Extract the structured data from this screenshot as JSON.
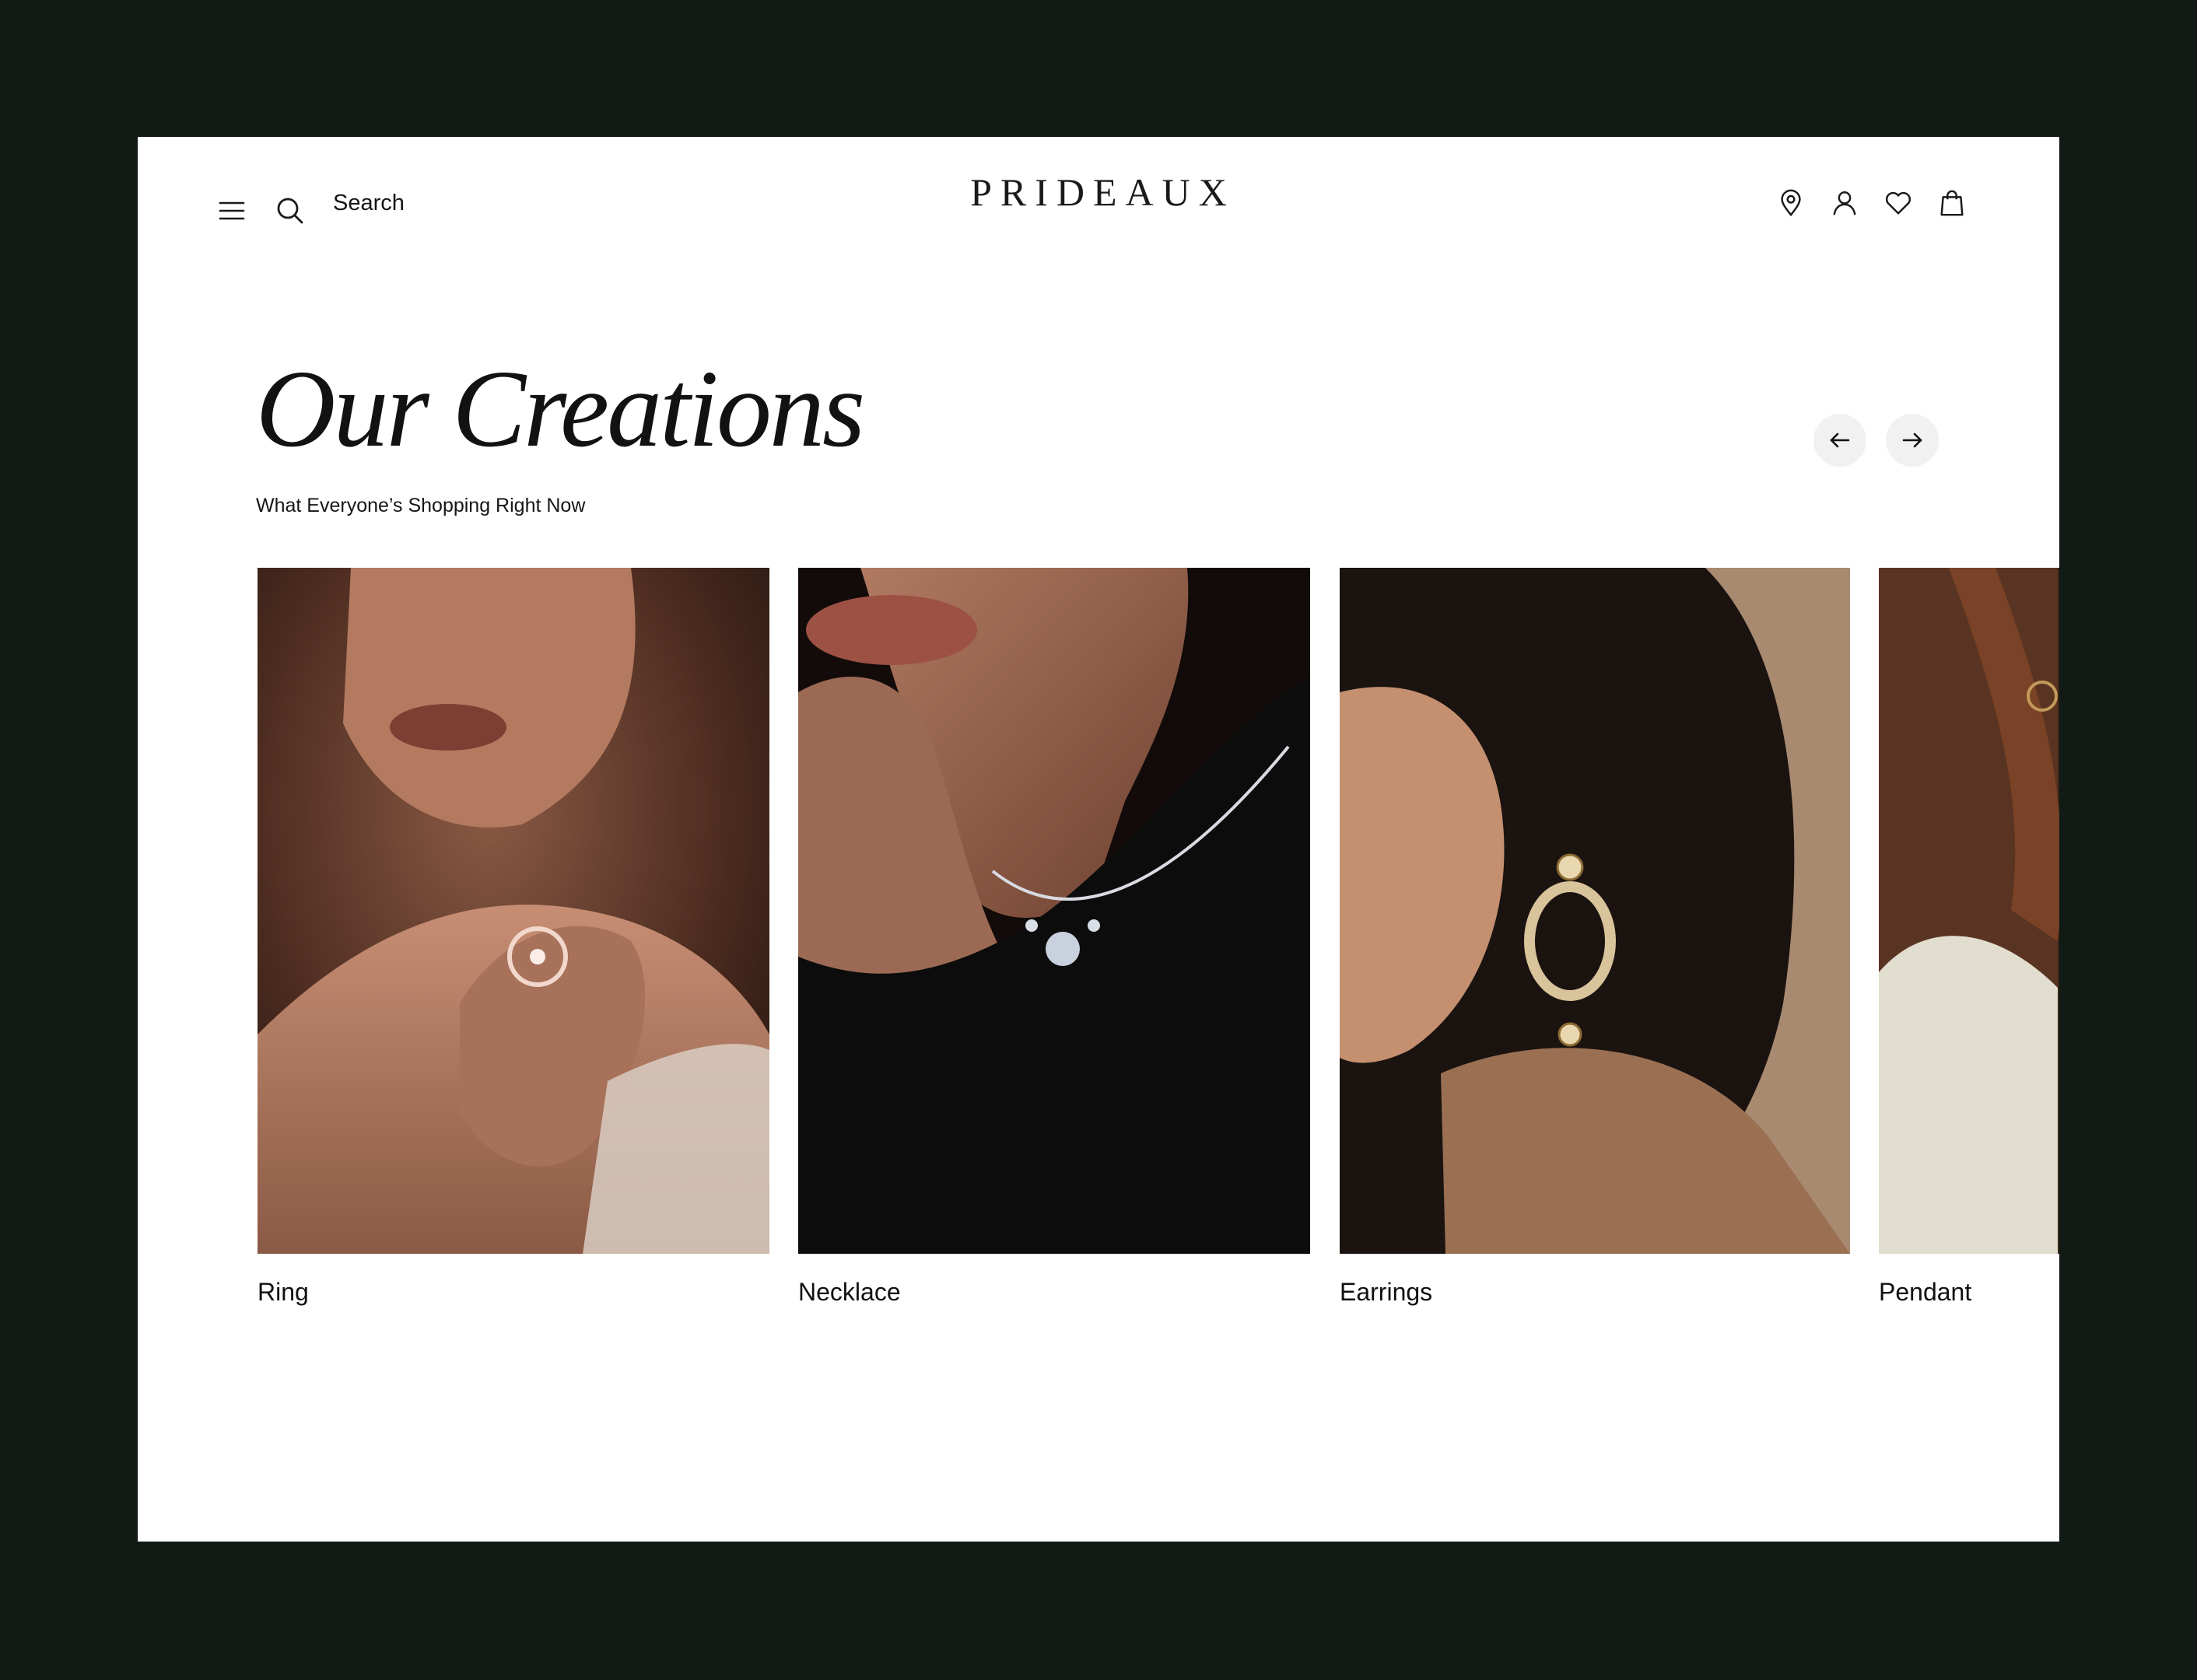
{
  "brand": {
    "name": "PRIDEAUX"
  },
  "header": {
    "menu_icon": "hamburger-icon",
    "search_icon": "search-icon",
    "search_label": "Search",
    "icons": [
      "location-pin-icon",
      "user-icon",
      "heart-icon",
      "shopping-bag-icon"
    ]
  },
  "section": {
    "title": "Our Creations",
    "subtitle": "What Everyone’s Shopping Right Now",
    "prev_icon": "arrow-left-icon",
    "next_icon": "arrow-right-icon"
  },
  "products": [
    {
      "label": "Ring"
    },
    {
      "label": "Necklace"
    },
    {
      "label": "Earrings"
    },
    {
      "label": "Pendant"
    }
  ],
  "colors": {
    "backdrop": "#111a14",
    "page": "#ffffff",
    "text": "#121212",
    "arrow_button_bg": "#f1f1f1"
  }
}
